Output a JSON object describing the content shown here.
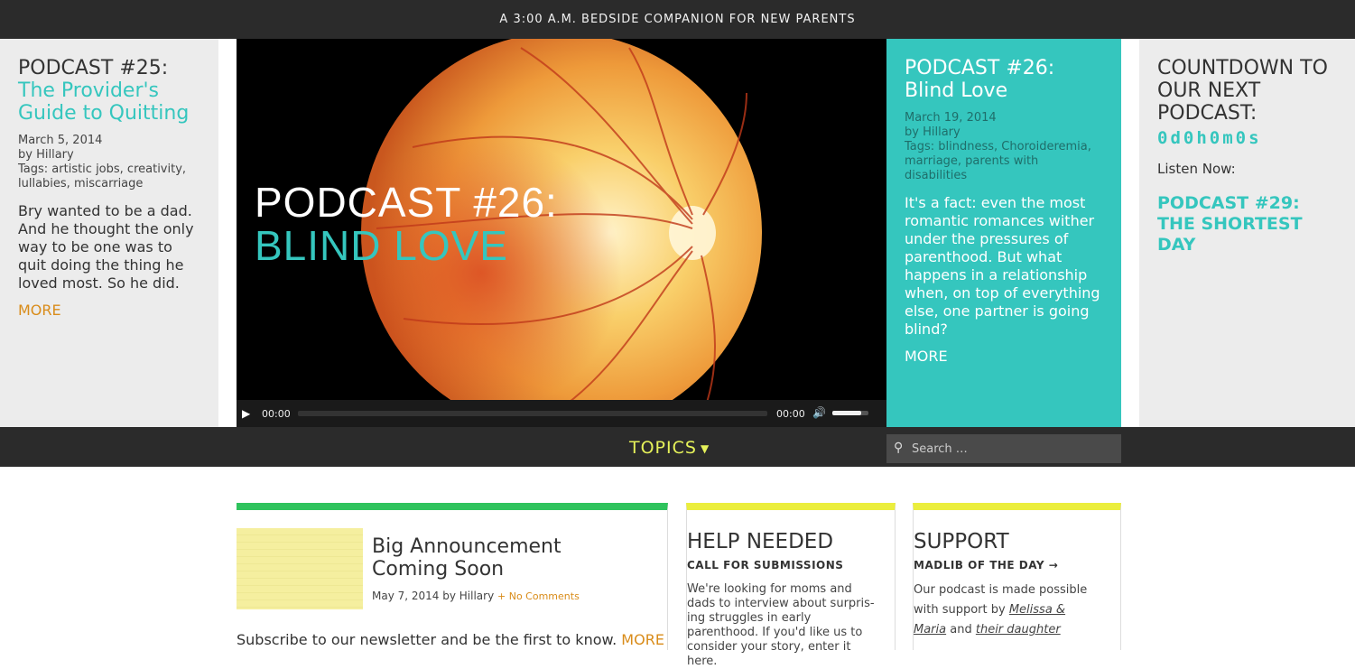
{
  "topbar": {
    "tagline": "A 3:00 A.M. BEDSIDE COMPANION FOR NEW PARENTS"
  },
  "left_post": {
    "title": "PODCAST #25:",
    "subtitle": "The Provider's Guide to Quitting",
    "date": "March 5, 2014",
    "author": "by Hillary",
    "tags": "Tags: artistic jobs, creativity, lullabies, miscarriage",
    "excerpt": "Bry wanted to be a dad. And he thought the only way to be one was to quit doing the thing he loved most. So he did.",
    "more": "MORE"
  },
  "video": {
    "overlay_title": "PODCAST #26:",
    "overlay_subtitle": "BLIND LOVE",
    "time_current": "00:00",
    "time_duration": "00:00",
    "progress": 0,
    "volume": 0.8
  },
  "featured_post": {
    "title": "PODCAST #26:",
    "subtitle": "Blind Love",
    "date": "March 19, 2014",
    "author": "by Hillary",
    "tags": "Tags: blindness, Choroideremia, marriage, parents with disabilities",
    "excerpt": "It's a fact: even the most romantic romances wither under the pressures of parenthood. But what happens in a relationship when, on top of everything else, one partner is going blind?",
    "more": "MORE"
  },
  "countdown": {
    "title": "COUNTDOWN TO OUR NEXT PODCAST:",
    "value": "0d0h0m0s",
    "listen_label": "Listen Now:",
    "podcast_link": "PODCAST #29: THE SHORTEST DAY"
  },
  "nav": {
    "topics_label": "TOPICS",
    "search_placeholder": "Search …"
  },
  "announcement": {
    "title": "Big Announcement Coming Soon",
    "date_author": "May 7, 2014 by Hillary",
    "comments": "+ No Comments",
    "text": "Subscribe to our newsletter and be the first to know.",
    "more": "MORE"
  },
  "help": {
    "title": "HELP NEEDED",
    "subtitle": "CALL FOR SUBMISSIONS",
    "body": "We're looking for moms and dads to interview about surpris-ing struggles in early parenthood. If you'd like us to consider your story, enter it here."
  },
  "support": {
    "title": "SUPPORT",
    "subtitle": "MADLIB OF THE DAY →",
    "body_prefix": "Our podcast is made possible with support by",
    "name1": "Melissa &",
    "name2": "Maria",
    "and_text": "and",
    "name3": "their daughter"
  },
  "colors": {
    "teal": "#35c6be",
    "dark": "#2b2b2b",
    "orange": "#d98c1a",
    "yellow": "#ebee3d",
    "green": "#2fc35d"
  }
}
